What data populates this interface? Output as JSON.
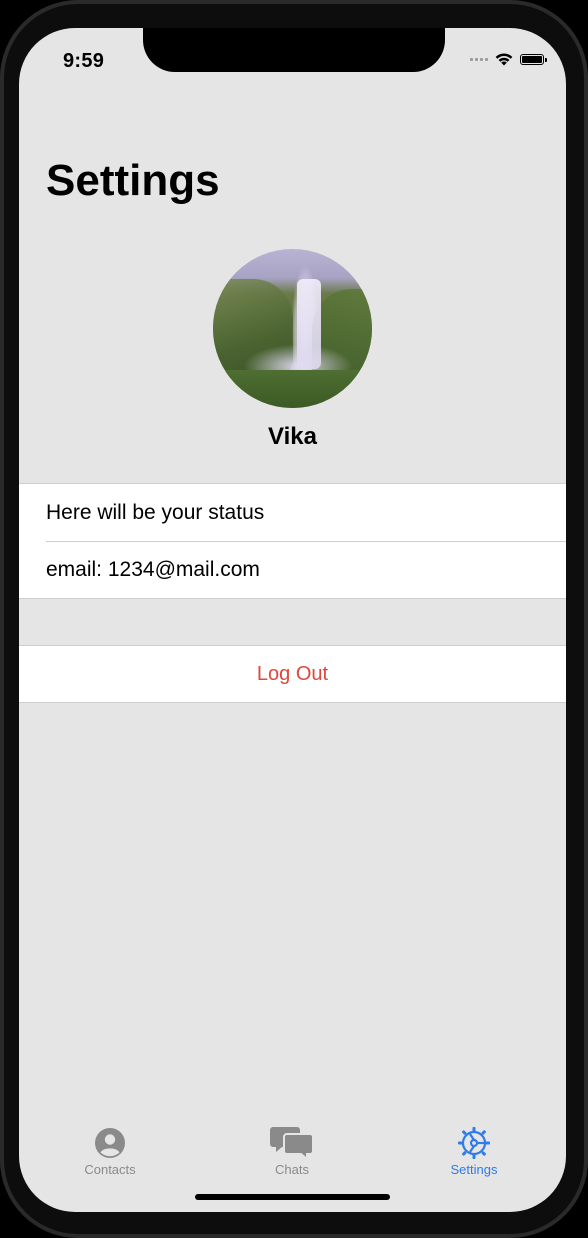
{
  "status_bar": {
    "time": "9:59"
  },
  "page": {
    "title": "Settings"
  },
  "profile": {
    "name": "Vika"
  },
  "info_rows": [
    {
      "text": "Here will be your status"
    },
    {
      "text": "email: 1234@mail.com"
    }
  ],
  "actions": {
    "logout_label": "Log Out"
  },
  "tabbar": {
    "tabs": [
      {
        "label": "Contacts",
        "icon": "person-circle-icon"
      },
      {
        "label": "Chats",
        "icon": "chat-bubbles-icon"
      },
      {
        "label": "Settings",
        "icon": "gear-icon",
        "active": true
      }
    ]
  },
  "colors": {
    "accent": "#2f7bea",
    "destructive": "#e0473b",
    "background": "#e5e5e5"
  }
}
